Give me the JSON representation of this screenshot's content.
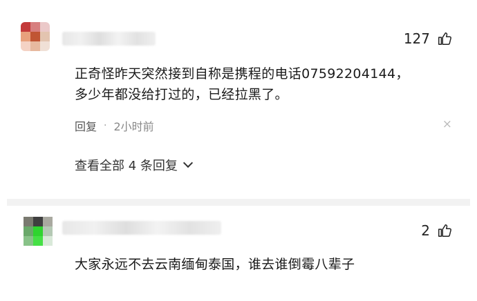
{
  "comments": [
    {
      "likes": "127",
      "text_line1": "正奇怪昨天突然接到自称是携程的电话07592204144，",
      "text_line2": "多少年都没给打过的，已经拉黑了。",
      "reply_label": "回复",
      "separator": "·",
      "time": "2小时前",
      "close_symbol": "×",
      "expand_label": "查看全部 4 条回复"
    },
    {
      "likes": "2",
      "text_line1": "大家永远不去云南缅甸泰国，谁去谁倒霉八辈子"
    }
  ],
  "icons": {
    "like": "thumbs-up-icon",
    "close": "close-icon",
    "expand": "chevron-down-icon"
  },
  "avatar_colors": {
    "first": [
      "#c33a3a",
      "#d77f7f",
      "#ebc9c9",
      "#e8a07c",
      "#c05534",
      "#e3c4b0",
      "#f4d2c4",
      "#e7b99f",
      "#f0e0d6"
    ],
    "second": [
      "#7a7a70",
      "#3f3f3f",
      "#a9a9a0",
      "#6aa86a",
      "#2fd42f",
      "#b5c9b5",
      "#88c288",
      "#45e045",
      "#d9e9d9"
    ]
  }
}
